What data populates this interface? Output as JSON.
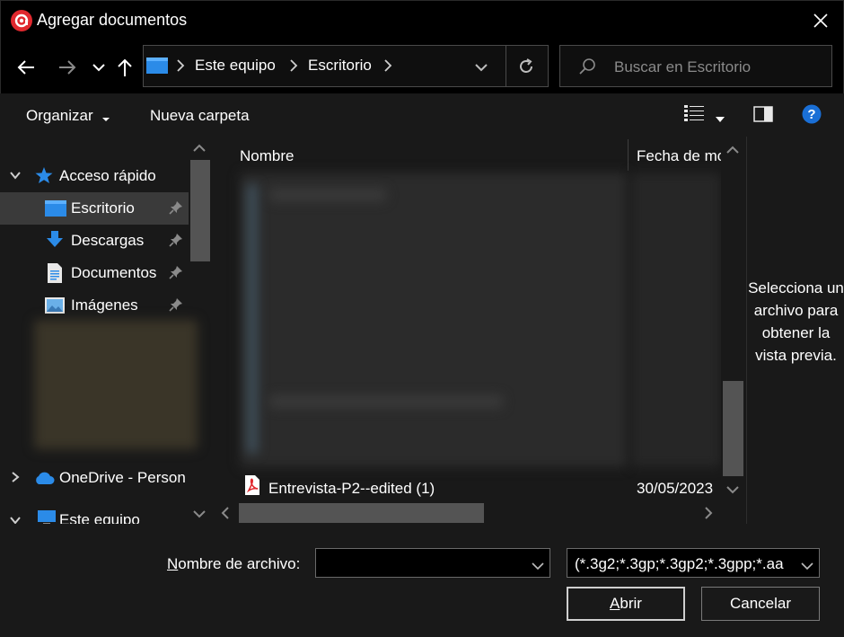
{
  "window": {
    "title": "Agregar documentos"
  },
  "address": {
    "crumbs": [
      "Este equipo",
      "Escritorio"
    ]
  },
  "search": {
    "placeholder": "Buscar en Escritorio"
  },
  "toolbar": {
    "organize_label": "Organizar",
    "new_folder_label": "Nueva carpeta"
  },
  "nav": {
    "quick_access": "Acceso rápido",
    "items": [
      {
        "label": "Escritorio",
        "icon": "desktop-icon"
      },
      {
        "label": "Descargas",
        "icon": "download-icon"
      },
      {
        "label": "Documentos",
        "icon": "documents-icon"
      },
      {
        "label": "Imágenes",
        "icon": "pictures-icon"
      }
    ],
    "onedrive": "OneDrive - Person",
    "this_pc": "Este equipo"
  },
  "files": {
    "columns": {
      "name": "Nombre",
      "date": "Fecha de mo"
    },
    "visible_row": {
      "name": "Entrevista-P2--edited (1)",
      "date": "30/05/2023"
    }
  },
  "preview": {
    "text": "Selecciona un archivo para obtener la vista previa."
  },
  "bottom": {
    "filename_label_u": "N",
    "filename_label_rest": "ombre de archivo:",
    "filename_value": "",
    "filetype_value": "(*.3g2;*.3gp;*.3gp2;*.3gpp;*.aa",
    "open_u": "A",
    "open_rest": "brir",
    "cancel_label": "Cancelar"
  },
  "colors": {
    "accent": "#0078d4",
    "logo": "#e0282e",
    "pdf": "#e0282e",
    "help": "#1a6fd6"
  }
}
